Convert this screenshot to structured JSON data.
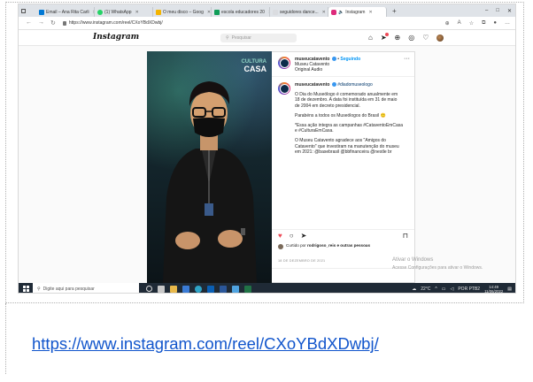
{
  "browser": {
    "tabs": [
      {
        "label": "Email – Ana Rita Carli",
        "color": "#0078d4",
        "active": false
      },
      {
        "label": "(1) WhatsApp",
        "color": "#25d366",
        "active": false
      },
      {
        "label": "O meu disco – Goog",
        "color": "#f4b400",
        "active": false
      },
      {
        "label": "escola educadores 20",
        "color": "#0f9d58",
        "active": false
      },
      {
        "label": "seguidores dance...",
        "color": "#dadce0",
        "active": false
      },
      {
        "label": "Instagram",
        "color": "#dd2a7b",
        "active": true
      }
    ],
    "new_tab": "+",
    "window_controls": [
      "–",
      "□",
      "✕"
    ],
    "url": "https://www.instagram.com/reel/CXoYBdXDwbj/"
  },
  "instagram": {
    "logo": "Instagram",
    "search_placeholder": "Pesquisar",
    "header_icons": [
      "home-icon",
      "direct-icon",
      "new-post-icon",
      "explore-icon",
      "activity-icon",
      "profile-avatar"
    ],
    "video": {
      "sign_line1": "CULTURA",
      "sign_line2": "CASA"
    },
    "post": {
      "username": "museucatavento",
      "follow": "Seguindo",
      "location": "Museu Catavento",
      "audio": "Original Audio",
      "caption_user": "museucatavento",
      "caption_tag": "#diadomuseologo",
      "paragraphs": [
        "O Dia do Museólogo é comemorado anualmente em 18 de dezembro. A data foi instituída em 31 de maio de 2004 em decreto presidencial.",
        "Parabéns a todos os Museólogos do Brasil 🙂",
        "*Essa ação integra as campanhas #CataventoEmCasa e #CulturaEmCasa.",
        "O Museu Catavento agradece aos \"Amigos do Catavento\" que investiram na manutenção do museu em 2021: @basebrasil @bbfinanceira @nestle br"
      ],
      "likes_prefix": "Curtido por",
      "likes_user": "rodrigoso_reis",
      "likes_suffix": "e outras pessoas",
      "date": "18 DE DEZEMBRO DE 2021"
    },
    "watermark_line1": "Ativar o Windows",
    "watermark_line2": "Acesse Configurações para ativar o Windows."
  },
  "taskbar": {
    "search_placeholder": "Digite aqui para pesquisar",
    "temperature": "22°C",
    "lang": "POR PTB2",
    "time": "14:49",
    "date": "11/06/2022"
  },
  "caption_link": "https://www.instagram.com/reel/CXoYBdXDwbj/"
}
